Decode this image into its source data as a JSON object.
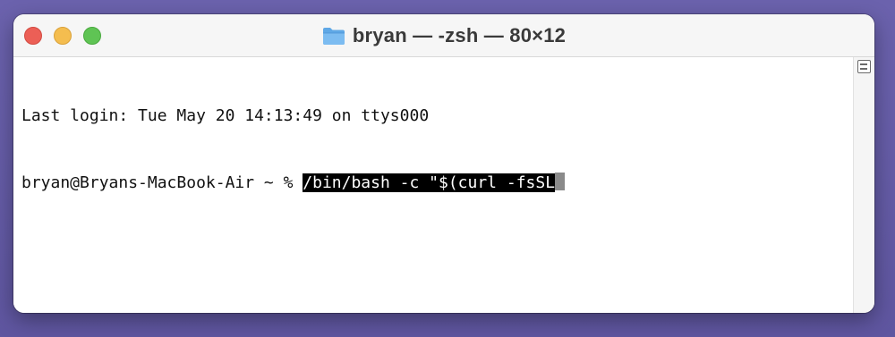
{
  "window": {
    "title": "bryan — -zsh — 80×12",
    "title_icon": "folder-icon"
  },
  "traffic_lights": {
    "close_color": "#ec5f56",
    "minimize_color": "#f4bd4f",
    "maximize_color": "#5fc454"
  },
  "terminal": {
    "last_login": "Last login: Tue May 20 14:13:49 on ttys000",
    "prompt": "bryan@Bryans-MacBook-Air ~ % ",
    "selected_command": "/bin/bash -c \"$(curl -fsSL"
  },
  "scrollbar": {
    "icon": "scroll-split-icon"
  }
}
